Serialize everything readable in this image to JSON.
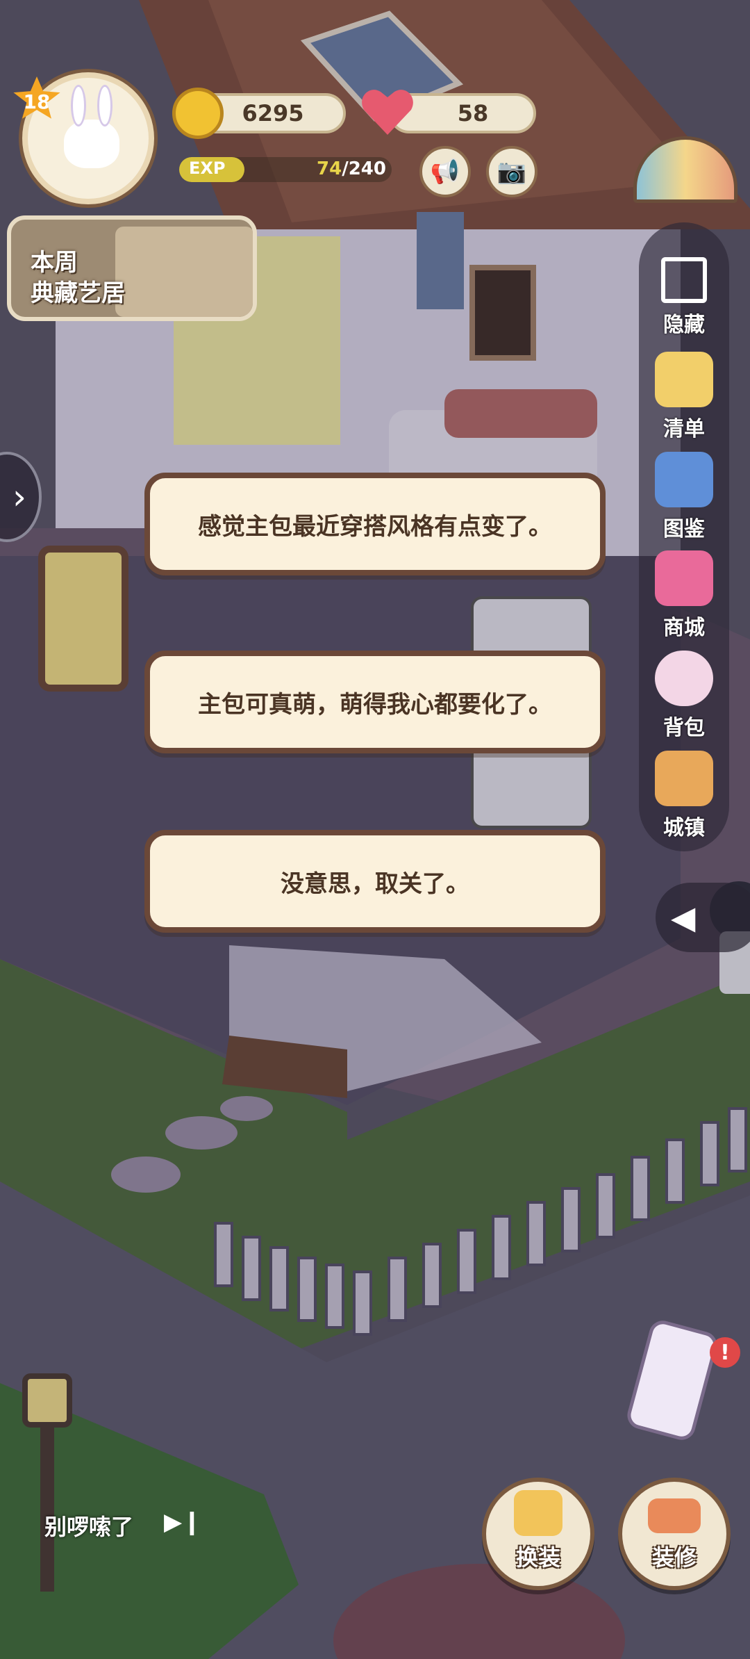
{
  "hud": {
    "level": "18",
    "coins": "6295",
    "hearts": "58",
    "exp_label": "EXP",
    "exp_current": "74",
    "exp_max": "/240",
    "exp_fraction": 0.308,
    "weekly_label_line1": "本周",
    "weekly_label_line2": "典藏艺居"
  },
  "menu": {
    "items": [
      {
        "label": "隐藏",
        "icon": "fullscreen-icon"
      },
      {
        "label": "清单",
        "icon": "checklist-icon"
      },
      {
        "label": "图鉴",
        "icon": "collection-book-icon"
      },
      {
        "label": "商城",
        "icon": "shop-icon"
      },
      {
        "label": "背包",
        "icon": "backpack-icon"
      },
      {
        "label": "城镇",
        "icon": "town-castle-icon"
      }
    ]
  },
  "dialog": {
    "options": [
      "感觉主包最近穿搭风格有点变了。",
      "主包可真萌，萌得我心都要化了。",
      "没意思，取关了。"
    ]
  },
  "bottom": {
    "music_title": "别啰嗦了",
    "outfit_label": "换装",
    "decorate_label": "装修"
  },
  "colors": {
    "bubble_bg": "#fbf1dc",
    "bubble_border": "#6b4838",
    "coin": "#f1c232",
    "heart": "#e65a6f",
    "exp": "#d7c23a",
    "grass": "#4f6b3f"
  }
}
